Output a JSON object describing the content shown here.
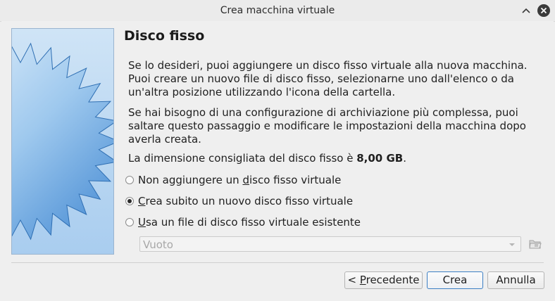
{
  "window": {
    "title": "Crea macchina virtuale"
  },
  "page": {
    "title": "Disco fisso",
    "para1": "Se lo desideri, puoi aggiungere un disco fisso virtuale alla nuova macchina. Puoi creare un nuovo file di disco fisso, selezionarne uno dall'elenco o da un'altra posizione utilizzando l'icona della cartella.",
    "para2": "Se hai bisogno di una configurazione di archiviazione più complessa, puoi saltare questo passaggio e modificare le impostazioni della macchina dopo averla creata.",
    "recommended_prefix": "La dimensione consigliata del disco fisso è ",
    "recommended_size": "8,00 GB",
    "recommended_suffix": "."
  },
  "options": [
    {
      "pre": "Non aggiungere un ",
      "mnemonic": "d",
      "post": "isco fisso virtuale",
      "checked": false
    },
    {
      "pre": "",
      "mnemonic": "C",
      "post": "rea subito un nuovo disco fisso virtuale",
      "checked": true
    },
    {
      "pre": "",
      "mnemonic": "U",
      "post": "sa un file di disco fisso virtuale esistente",
      "checked": false
    }
  ],
  "combo": {
    "value": "Vuoto",
    "enabled": false
  },
  "buttons": {
    "back_prefix": "< ",
    "back_mnemonic": "P",
    "back_rest": "recedente",
    "create": "Crea",
    "cancel": "Annulla"
  },
  "icons": {
    "shade": "chevron-up-icon",
    "close": "close-circle-icon",
    "folder": "folder-icon"
  },
  "colors": {
    "accent": "#3c7fc4",
    "banner_star": "#4a90d9"
  }
}
